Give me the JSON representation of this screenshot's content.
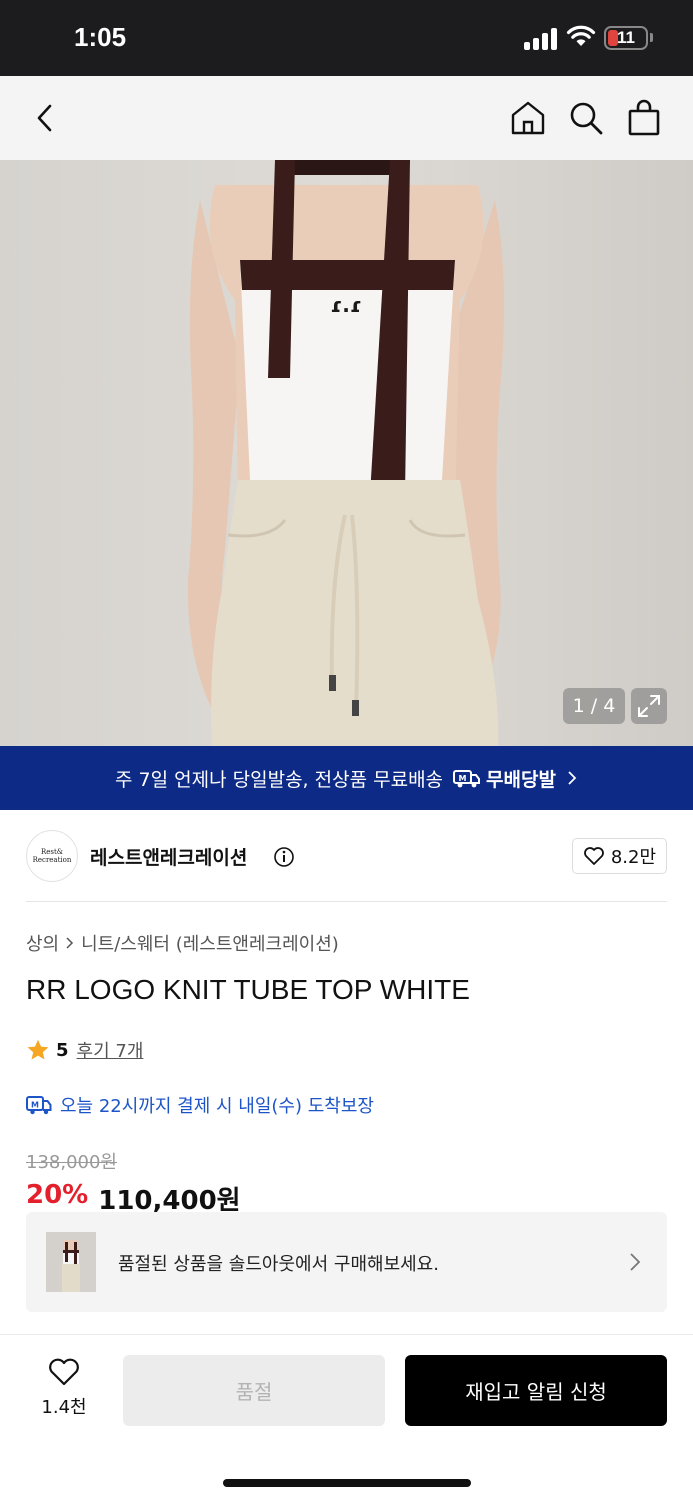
{
  "status_bar": {
    "time": "1:05",
    "battery": "11",
    "battery_color": "#e0443e"
  },
  "nav": {
    "back_icon": "chevron-left-icon",
    "home_icon": "home-icon",
    "search_icon": "search-icon",
    "bag_icon": "shopping-bag-icon"
  },
  "gallery": {
    "counter": "1 / 4",
    "expand_icon": "expand-icon"
  },
  "banner": {
    "text": "주 7일 언제나 당일발송, 전상품 무료배송",
    "badge": "무배당발",
    "badge_icon": "delivery-truck-icon",
    "background": "#0d2a86"
  },
  "brand": {
    "logo_text": "Rest& Recreation",
    "name": "레스트앤레크레이션",
    "likes": "8.2만"
  },
  "breadcrumb": {
    "category": "상의",
    "subcategory": "니트/스웨터 (레스트앤레크레이션)"
  },
  "product": {
    "title": "RR LOGO KNIT TUBE TOP WHITE"
  },
  "rating": {
    "score": "5",
    "reviews": "후기 7개",
    "star_color": "#f5a623"
  },
  "delivery": {
    "text": "오늘 22시까지 결제 시 내일(수) 도착보장",
    "color": "#1d55c8"
  },
  "price": {
    "original": "138,000원",
    "discount": "20%",
    "sale": "110,400원",
    "discount_color": "#e3202c"
  },
  "soldout_promo": {
    "text": "품절된 상품을 솔드아웃에서 구매해보세요."
  },
  "bottom_bar": {
    "wish_count": "1.4천",
    "soldout_label": "품절",
    "restock_label": "재입고 알림 신청"
  }
}
